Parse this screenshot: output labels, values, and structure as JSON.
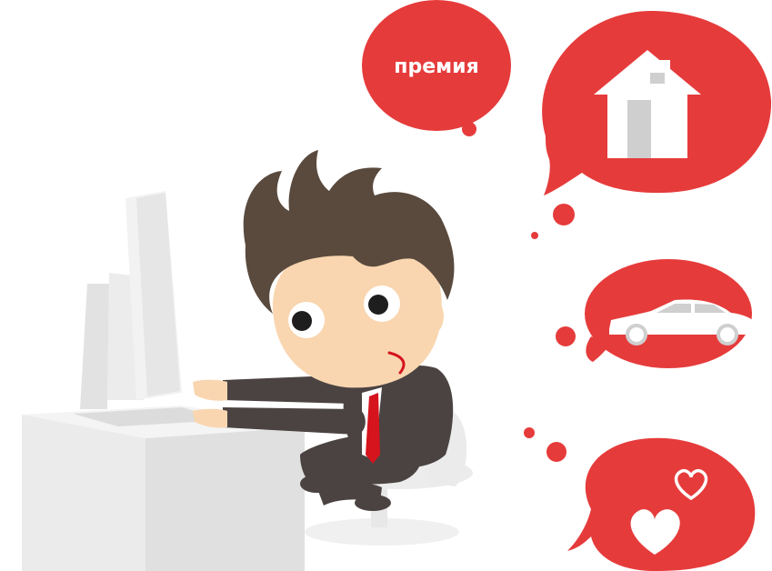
{
  "bubble_texts": {
    "bonus": "премия"
  },
  "colors": {
    "bubble_red": "#e63b3b",
    "bubble_icon_grey": "#cfcfd0",
    "hair": "#5a4a3e",
    "skin": "#f9d6b0",
    "suit": "#4b4342",
    "tie": "#d5141d",
    "desk_monitor": "#eeeeee"
  },
  "bubbles": [
    {
      "content": "text",
      "icon": "none"
    },
    {
      "content": "icon",
      "icon": "house-icon"
    },
    {
      "content": "icon",
      "icon": "car-icon"
    },
    {
      "content": "icon",
      "icon": "hearts-icon"
    }
  ]
}
